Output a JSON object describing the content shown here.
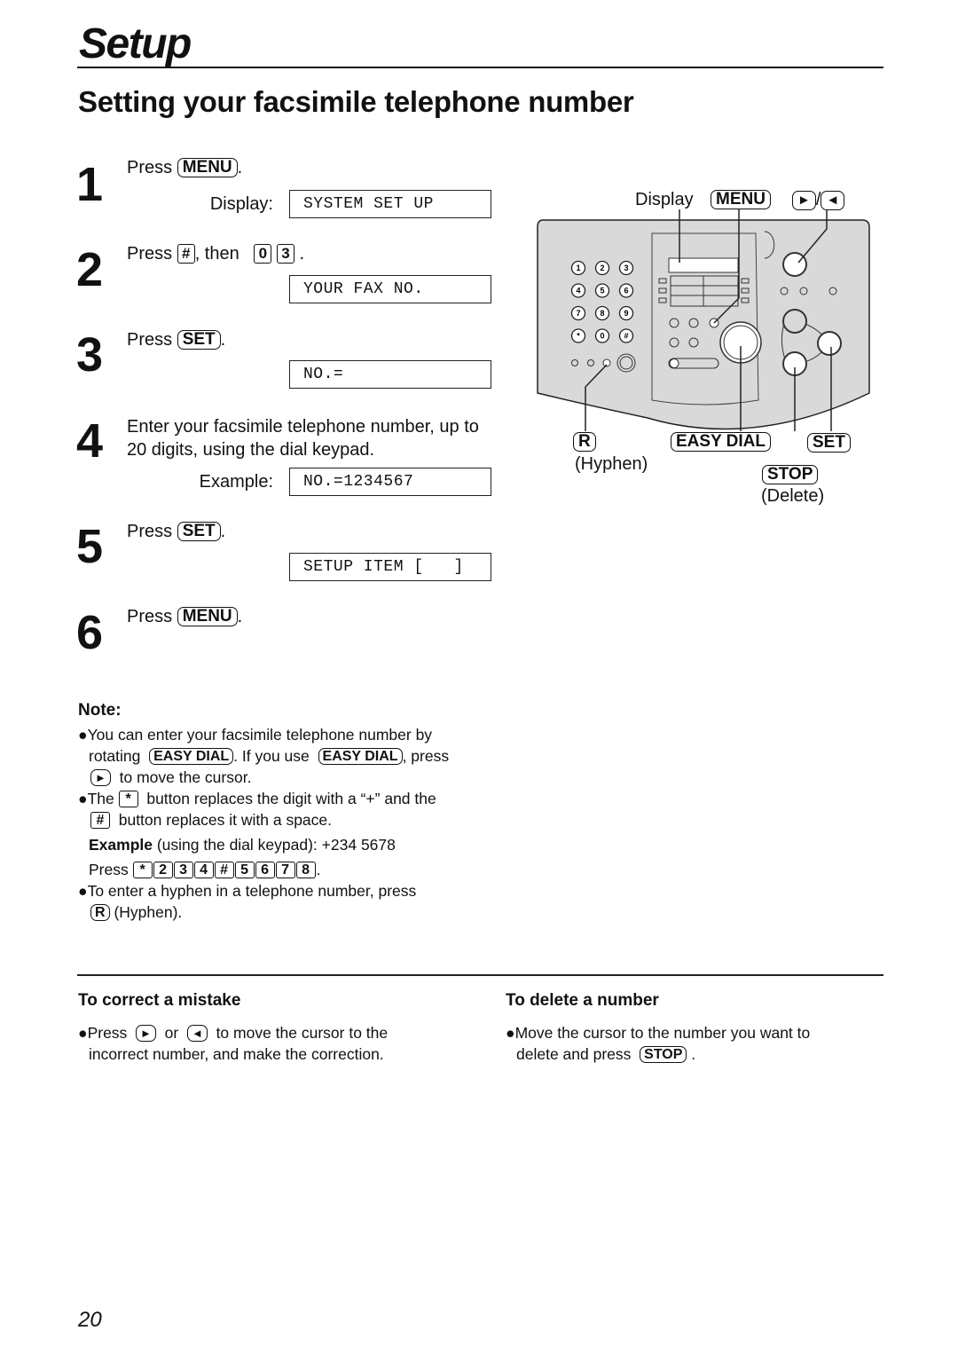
{
  "header": {
    "section": "Setup",
    "title": "Setting your facsimile telephone number"
  },
  "steps": [
    {
      "num": "1",
      "prefix": "Press",
      "keys": [
        "MENU"
      ],
      "suffix": ".",
      "display_label": "Display:",
      "display": "SYSTEM SET UP"
    },
    {
      "num": "2",
      "prefix": "Press",
      "keys": [
        "#",
        "0",
        "3"
      ],
      "middle": ", then",
      "suffix": ".",
      "display": "YOUR FAX NO."
    },
    {
      "num": "3",
      "prefix": "Press",
      "keys": [
        "SET"
      ],
      "suffix": ".",
      "display": "NO.="
    },
    {
      "num": "4",
      "text_line1": "Enter your facsimile telephone number, up to",
      "text_line2": "20 digits, using the dial keypad.",
      "display_label": "Example:",
      "display": "NO.=1234567"
    },
    {
      "num": "5",
      "prefix": "Press",
      "keys": [
        "SET"
      ],
      "suffix": ".",
      "display": "SETUP ITEM [   ]"
    },
    {
      "num": "6",
      "prefix": "Press",
      "keys": [
        "MENU"
      ],
      "suffix": "."
    }
  ],
  "diagram": {
    "label_display": "Display",
    "key_menu": "MENU",
    "key_right": "►",
    "key_left": "◄",
    "slash": "/",
    "key_r": "R",
    "label_hyphen": "(Hyphen)",
    "key_easy_dial": "EASY DIAL",
    "key_set": "SET",
    "key_stop": "STOP",
    "label_delete": "(Delete)",
    "keypad": [
      "1",
      "2",
      "3",
      "4",
      "5",
      "6",
      "7",
      "8",
      "9",
      "*",
      "0",
      "#"
    ],
    "panel_color": "#d9d9d9"
  },
  "note": {
    "heading": "Note:",
    "b1_l1": "You can enter your facsimile telephone number by",
    "b1_l2a": "rotating",
    "b1_key1": "EASY DIAL",
    "b1_l2b": ". If you use",
    "b1_key2": "EASY DIAL",
    "b1_l2c": ", press",
    "b1_key3": "►",
    "b1_l3": "to move the cursor.",
    "b2_l1a": "The",
    "b2_key1": "*",
    "b2_l1b": "button replaces the digit with a “+” and the",
    "b2_key2": "#",
    "b2_l2": "button replaces it with a space.",
    "example_bold": "Example",
    "example_rest": "(using the dial keypad):  +234  5678",
    "press": "Press",
    "example_keys": [
      "*",
      "2",
      "3",
      "4",
      "#",
      "5",
      "6",
      "7",
      "8"
    ],
    "period": ".",
    "b3_l1": "To enter a hyphen in a telephone number, press",
    "b3_key": "R",
    "b3_l2": "(Hyphen)."
  },
  "correct": {
    "heading": "To correct a mistake",
    "l1a": "Press",
    "key1": "►",
    "or": "or",
    "key2": "◄",
    "l1b": "to move the cursor to the",
    "l2": "incorrect number, and make the correction."
  },
  "delete": {
    "heading": "To delete a number",
    "l1": "Move the cursor to the number you want to",
    "l2a": "delete and press",
    "key": "STOP",
    "period": "."
  },
  "footer": {
    "page_number": "20"
  }
}
